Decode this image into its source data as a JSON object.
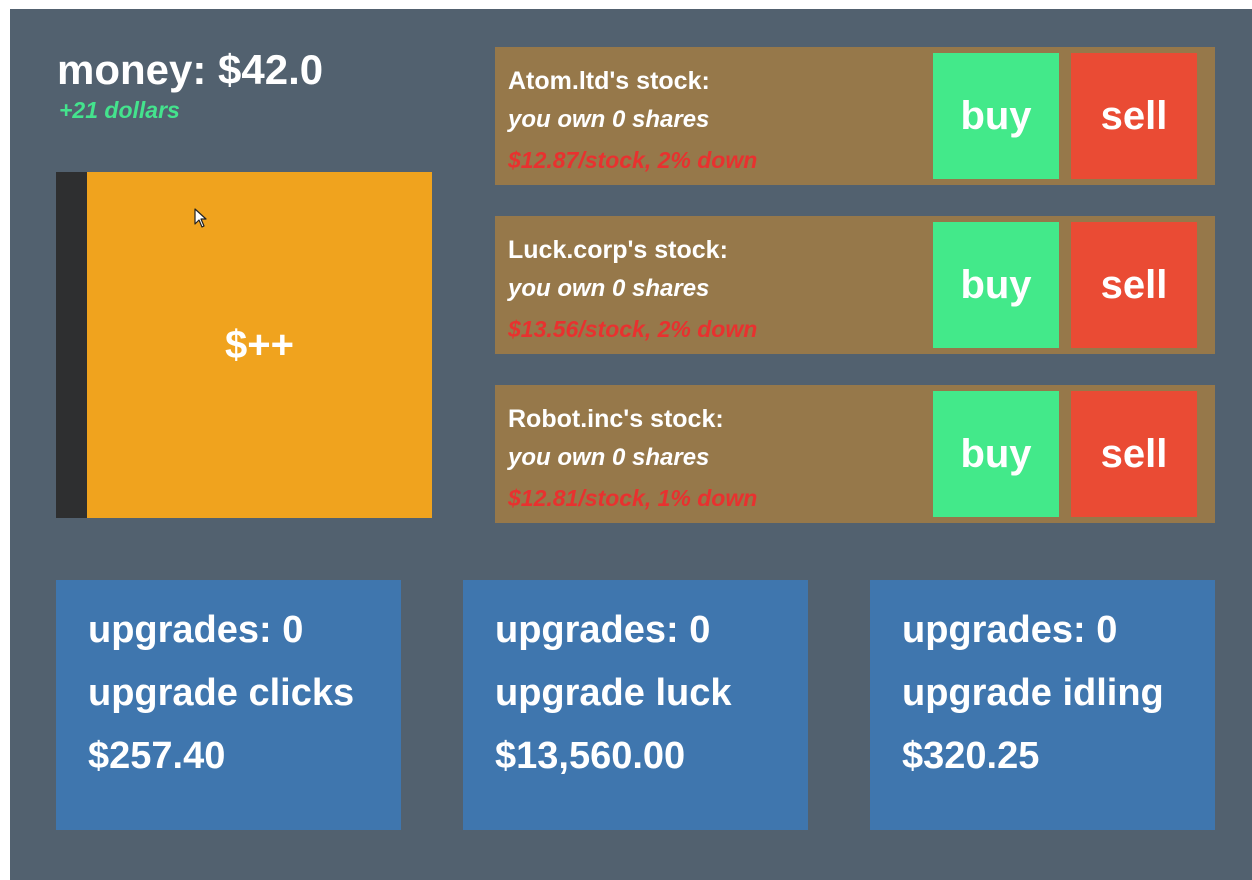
{
  "money": {
    "label": "money: $42.0",
    "income": "+21 dollars"
  },
  "clicker": {
    "label": "$++"
  },
  "stocks": [
    {
      "name": "Atom.ltd's stock:",
      "shares": "you own 0 shares",
      "price": "$12.87/stock, 2% down",
      "buy": "buy",
      "sell": "sell"
    },
    {
      "name": "Luck.corp's stock:",
      "shares": "you own 0 shares",
      "price": "$13.56/stock, 2% down",
      "buy": "buy",
      "sell": "sell"
    },
    {
      "name": "Robot.inc's stock:",
      "shares": "you own 0 shares",
      "price": "$12.81/stock, 1% down",
      "buy": "buy",
      "sell": "sell"
    }
  ],
  "upgrades": [
    {
      "count": "upgrades: 0",
      "title": "upgrade clicks",
      "cost": "$257.40"
    },
    {
      "count": "upgrades: 0",
      "title": "upgrade luck",
      "cost": "$13,560.00"
    },
    {
      "count": "upgrades: 0",
      "title": "upgrade idling",
      "cost": "$320.25"
    }
  ],
  "colors": {
    "background": "#52616f",
    "clicker": "#f0a31e",
    "stock_panel": "#96784a",
    "buy": "#43e98a",
    "sell": "#ea4b34",
    "upgrade_panel": "#3f76ae",
    "income_text": "#44e38d",
    "price_text": "#e8312f"
  },
  "icons": {
    "pointer": "mouse-pointer-icon"
  }
}
